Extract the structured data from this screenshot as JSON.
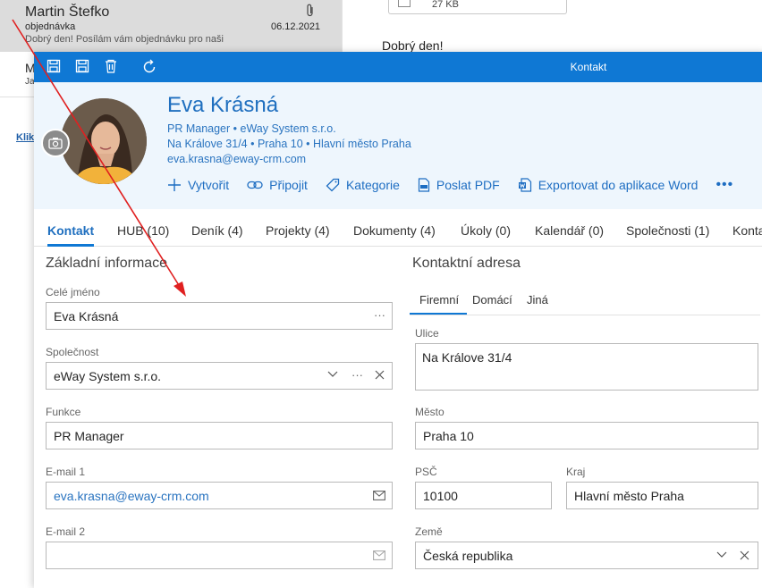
{
  "background": {
    "mail": {
      "sender": "Martin Štefko",
      "subject": "objednávka",
      "date": "06.12.2021",
      "preview": "Dobrý den!  Posílám vám objednávku pro naši"
    },
    "mail2": {
      "initial": "M",
      "initial2": "Ja"
    },
    "link_text": "Klik",
    "attachment_size": "27 KB",
    "greeting": "Dobrý den!"
  },
  "window": {
    "title": "Kontakt"
  },
  "contact": {
    "name": "Eva Krásná",
    "role_line": "PR Manager • eWay System s.r.o.",
    "address_line": "Na Králove 31/4 • Praha 10 • Hlavní město Praha",
    "email": "eva.krasna@eway-crm.com"
  },
  "actions": [
    {
      "label": "Vytvořit",
      "icon": "plus-icon"
    },
    {
      "label": "Připojit",
      "icon": "link-icon"
    },
    {
      "label": "Kategorie",
      "icon": "tag-icon"
    },
    {
      "label": "Poslat PDF",
      "icon": "pdf-icon"
    },
    {
      "label": "Exportovat do aplikace Word",
      "icon": "word-icon"
    }
  ],
  "more_label": "•••",
  "tabs": [
    {
      "label": "Kontakt"
    },
    {
      "label": "HUB (10)"
    },
    {
      "label": "Deník (4)"
    },
    {
      "label": "Projekty (4)"
    },
    {
      "label": "Dokumenty (4)"
    },
    {
      "label": "Úkoly (0)"
    },
    {
      "label": "Kalendář (0)"
    },
    {
      "label": "Společnosti (1)"
    },
    {
      "label": "Konta"
    }
  ],
  "basic": {
    "title": "Základní informace",
    "full_name_label": "Celé jméno",
    "full_name": "Eva Krásná",
    "company_label": "Společnost",
    "company": "eWay System s.r.o.",
    "function_label": "Funkce",
    "function": "PR Manager",
    "email1_label": "E-mail 1",
    "email1": "eva.krasna@eway-crm.com",
    "email2_label": "E-mail 2",
    "email2": ""
  },
  "address": {
    "title": "Kontaktní adresa",
    "subtabs": [
      "Firemní",
      "Domácí",
      "Jiná"
    ],
    "street_label": "Ulice",
    "street": "Na Králove 31/4",
    "city_label": "Město",
    "city": "Praha 10",
    "zip_label": "PSČ",
    "zip": "10100",
    "region_label": "Kraj",
    "region": "Hlavní město Praha",
    "country_label": "Země",
    "country": "Česká republika"
  },
  "colors": {
    "accent": "#0f78d4",
    "link": "#1f6fbf",
    "header_bg": "#eef6fd",
    "annotation": "#e02020"
  }
}
